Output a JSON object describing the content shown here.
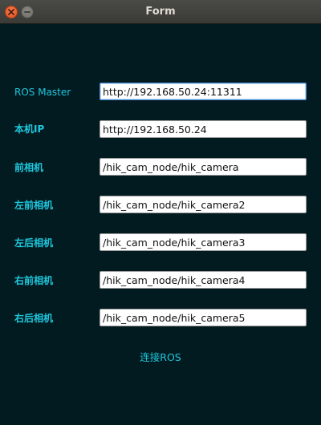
{
  "window": {
    "title": "Form"
  },
  "icons": {
    "close": "close-icon",
    "minimize": "minimize-icon"
  },
  "colors": {
    "background": "#021b20",
    "label": "#1ec8de",
    "close_button": "#e2521d"
  },
  "form": {
    "fields": [
      {
        "label": "ROS Master",
        "value": "http://192.168.50.24:11311"
      },
      {
        "label": "本机IP",
        "value": "http://192.168.50.24"
      },
      {
        "label": "前相机",
        "value": "/hik_cam_node/hik_camera"
      },
      {
        "label": "左前相机",
        "value": "/hik_cam_node/hik_camera2"
      },
      {
        "label": "左后相机",
        "value": "/hik_cam_node/hik_camera3"
      },
      {
        "label": "右前相机",
        "value": "/hik_cam_node/hik_camera4"
      },
      {
        "label": "右后相机",
        "value": "/hik_cam_node/hik_camera5"
      }
    ],
    "connect_label": "连接ROS"
  }
}
